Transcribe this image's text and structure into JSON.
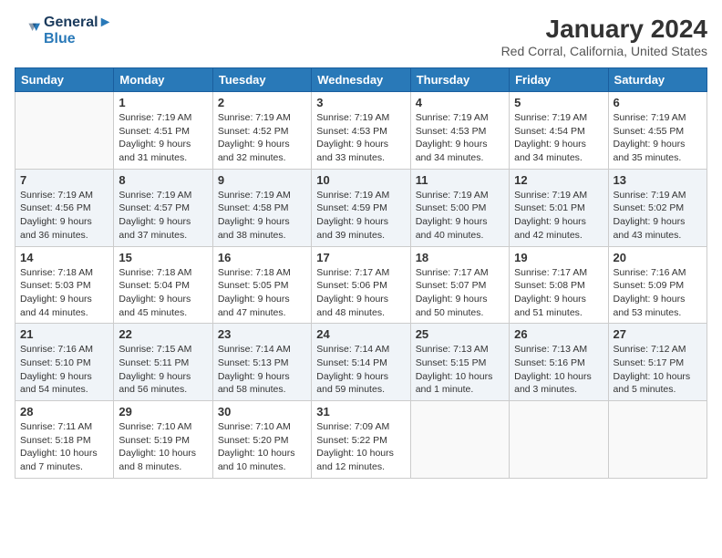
{
  "header": {
    "logo_line1": "General",
    "logo_line2": "Blue",
    "month_year": "January 2024",
    "location": "Red Corral, California, United States"
  },
  "days_of_week": [
    "Sunday",
    "Monday",
    "Tuesday",
    "Wednesday",
    "Thursday",
    "Friday",
    "Saturday"
  ],
  "weeks": [
    [
      {
        "day": "",
        "info": ""
      },
      {
        "day": "1",
        "info": "Sunrise: 7:19 AM\nSunset: 4:51 PM\nDaylight: 9 hours\nand 31 minutes."
      },
      {
        "day": "2",
        "info": "Sunrise: 7:19 AM\nSunset: 4:52 PM\nDaylight: 9 hours\nand 32 minutes."
      },
      {
        "day": "3",
        "info": "Sunrise: 7:19 AM\nSunset: 4:53 PM\nDaylight: 9 hours\nand 33 minutes."
      },
      {
        "day": "4",
        "info": "Sunrise: 7:19 AM\nSunset: 4:53 PM\nDaylight: 9 hours\nand 34 minutes."
      },
      {
        "day": "5",
        "info": "Sunrise: 7:19 AM\nSunset: 4:54 PM\nDaylight: 9 hours\nand 34 minutes."
      },
      {
        "day": "6",
        "info": "Sunrise: 7:19 AM\nSunset: 4:55 PM\nDaylight: 9 hours\nand 35 minutes."
      }
    ],
    [
      {
        "day": "7",
        "info": "Sunrise: 7:19 AM\nSunset: 4:56 PM\nDaylight: 9 hours\nand 36 minutes."
      },
      {
        "day": "8",
        "info": "Sunrise: 7:19 AM\nSunset: 4:57 PM\nDaylight: 9 hours\nand 37 minutes."
      },
      {
        "day": "9",
        "info": "Sunrise: 7:19 AM\nSunset: 4:58 PM\nDaylight: 9 hours\nand 38 minutes."
      },
      {
        "day": "10",
        "info": "Sunrise: 7:19 AM\nSunset: 4:59 PM\nDaylight: 9 hours\nand 39 minutes."
      },
      {
        "day": "11",
        "info": "Sunrise: 7:19 AM\nSunset: 5:00 PM\nDaylight: 9 hours\nand 40 minutes."
      },
      {
        "day": "12",
        "info": "Sunrise: 7:19 AM\nSunset: 5:01 PM\nDaylight: 9 hours\nand 42 minutes."
      },
      {
        "day": "13",
        "info": "Sunrise: 7:19 AM\nSunset: 5:02 PM\nDaylight: 9 hours\nand 43 minutes."
      }
    ],
    [
      {
        "day": "14",
        "info": "Sunrise: 7:18 AM\nSunset: 5:03 PM\nDaylight: 9 hours\nand 44 minutes."
      },
      {
        "day": "15",
        "info": "Sunrise: 7:18 AM\nSunset: 5:04 PM\nDaylight: 9 hours\nand 45 minutes."
      },
      {
        "day": "16",
        "info": "Sunrise: 7:18 AM\nSunset: 5:05 PM\nDaylight: 9 hours\nand 47 minutes."
      },
      {
        "day": "17",
        "info": "Sunrise: 7:17 AM\nSunset: 5:06 PM\nDaylight: 9 hours\nand 48 minutes."
      },
      {
        "day": "18",
        "info": "Sunrise: 7:17 AM\nSunset: 5:07 PM\nDaylight: 9 hours\nand 50 minutes."
      },
      {
        "day": "19",
        "info": "Sunrise: 7:17 AM\nSunset: 5:08 PM\nDaylight: 9 hours\nand 51 minutes."
      },
      {
        "day": "20",
        "info": "Sunrise: 7:16 AM\nSunset: 5:09 PM\nDaylight: 9 hours\nand 53 minutes."
      }
    ],
    [
      {
        "day": "21",
        "info": "Sunrise: 7:16 AM\nSunset: 5:10 PM\nDaylight: 9 hours\nand 54 minutes."
      },
      {
        "day": "22",
        "info": "Sunrise: 7:15 AM\nSunset: 5:11 PM\nDaylight: 9 hours\nand 56 minutes."
      },
      {
        "day": "23",
        "info": "Sunrise: 7:14 AM\nSunset: 5:13 PM\nDaylight: 9 hours\nand 58 minutes."
      },
      {
        "day": "24",
        "info": "Sunrise: 7:14 AM\nSunset: 5:14 PM\nDaylight: 9 hours\nand 59 minutes."
      },
      {
        "day": "25",
        "info": "Sunrise: 7:13 AM\nSunset: 5:15 PM\nDaylight: 10 hours\nand 1 minute."
      },
      {
        "day": "26",
        "info": "Sunrise: 7:13 AM\nSunset: 5:16 PM\nDaylight: 10 hours\nand 3 minutes."
      },
      {
        "day": "27",
        "info": "Sunrise: 7:12 AM\nSunset: 5:17 PM\nDaylight: 10 hours\nand 5 minutes."
      }
    ],
    [
      {
        "day": "28",
        "info": "Sunrise: 7:11 AM\nSunset: 5:18 PM\nDaylight: 10 hours\nand 7 minutes."
      },
      {
        "day": "29",
        "info": "Sunrise: 7:10 AM\nSunset: 5:19 PM\nDaylight: 10 hours\nand 8 minutes."
      },
      {
        "day": "30",
        "info": "Sunrise: 7:10 AM\nSunset: 5:20 PM\nDaylight: 10 hours\nand 10 minutes."
      },
      {
        "day": "31",
        "info": "Sunrise: 7:09 AM\nSunset: 5:22 PM\nDaylight: 10 hours\nand 12 minutes."
      },
      {
        "day": "",
        "info": ""
      },
      {
        "day": "",
        "info": ""
      },
      {
        "day": "",
        "info": ""
      }
    ]
  ]
}
